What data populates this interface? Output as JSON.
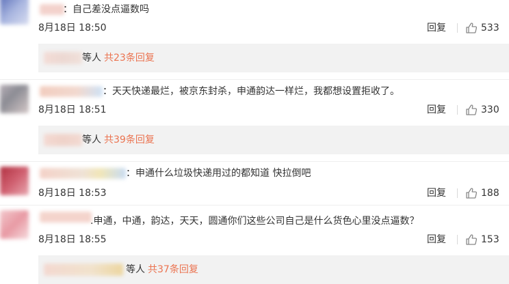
{
  "colors": {
    "link": "#eb7350",
    "reply_bg": "#f2f2f2"
  },
  "comments": [
    {
      "text": "：自己差没点逼数吗",
      "time": "8月18日 18:50",
      "reply_label": "回复",
      "likes": "533",
      "subreply": {
        "who": "等人",
        "count": "共23条回复"
      }
    },
    {
      "text": "：天天快递最烂，被京东封杀，申通韵达一样烂，我都想设置拒收了。",
      "time": "8月18日 18:51",
      "reply_label": "回复",
      "likes": "330",
      "subreply": {
        "who": "等人",
        "count": "共39条回复"
      }
    },
    {
      "text": "：申通什么垃圾快递用过的都知道 快拉倒吧",
      "time": "8月18日 18:53",
      "reply_label": "回复",
      "likes": "188"
    },
    {
      "text": ".申通，中通，韵达，天天，圆通你们这些公司自己是什么货色心里没点逼数？",
      "time": "8月18日 18:55",
      "reply_label": "回复",
      "likes": "153",
      "subreply": {
        "who": "等人",
        "count": "共37条回复"
      }
    }
  ]
}
